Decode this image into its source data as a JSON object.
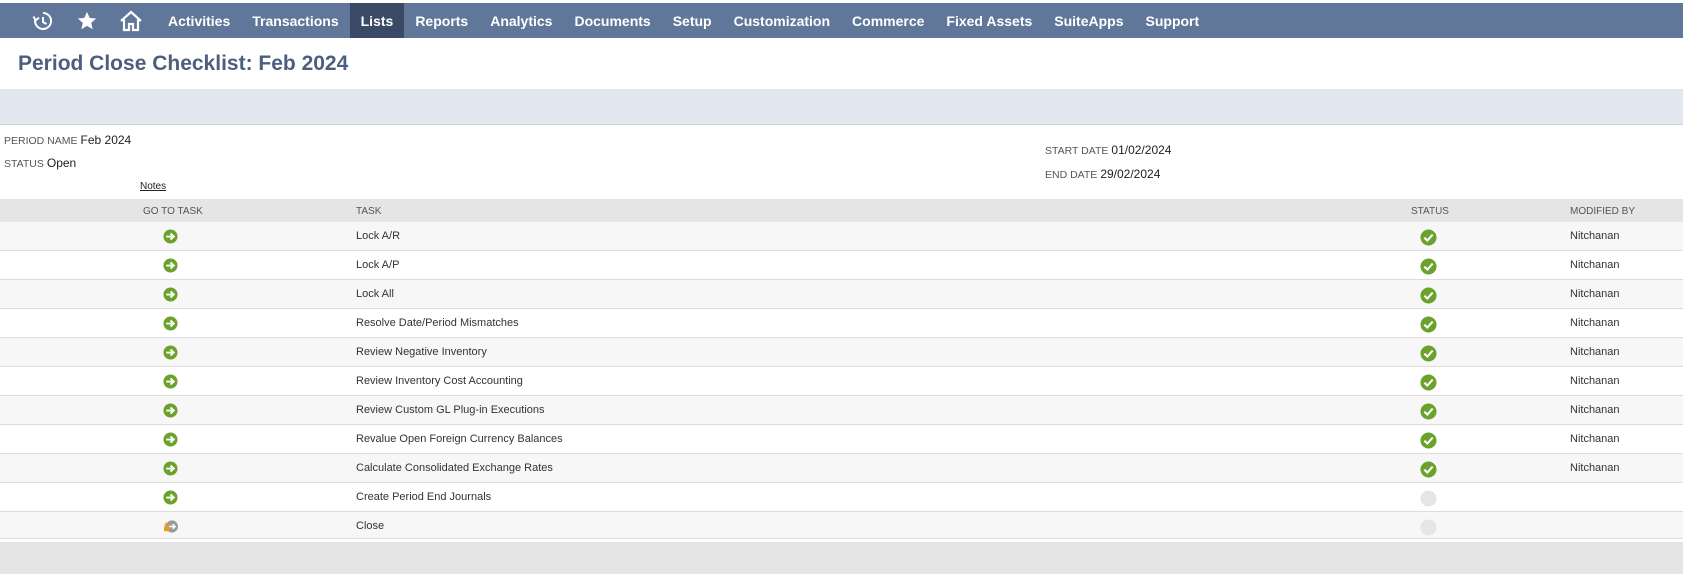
{
  "nav": {
    "icons": [
      "recent-records-icon",
      "star-icon",
      "home-icon"
    ],
    "items": [
      "Activities",
      "Transactions",
      "Lists",
      "Reports",
      "Analytics",
      "Documents",
      "Setup",
      "Customization",
      "Commerce",
      "Fixed Assets",
      "SuiteApps",
      "Support"
    ],
    "active": "Lists"
  },
  "page": {
    "title": "Period Close Checklist: Feb 2024"
  },
  "fields": {
    "period_name": {
      "label": "Period Name",
      "value": "Feb 2024"
    },
    "status": {
      "label": "Status",
      "value": "Open"
    },
    "notes": "Notes",
    "start_date": {
      "label": "Start Date",
      "value": "01/02/2024"
    },
    "end_date": {
      "label": "End Date",
      "value": "29/02/2024"
    }
  },
  "table": {
    "columns": [
      "Go To Task",
      "Task",
      "Status",
      "Modified By"
    ],
    "rows": [
      {
        "task": "Lock A/R",
        "status": "complete",
        "modified_by": "Nitchanan",
        "goto": "arrow"
      },
      {
        "task": "Lock A/P",
        "status": "complete",
        "modified_by": "Nitchanan",
        "goto": "arrow"
      },
      {
        "task": "Lock All",
        "status": "complete",
        "modified_by": "Nitchanan",
        "goto": "arrow"
      },
      {
        "task": "Resolve Date/Period Mismatches",
        "status": "complete",
        "modified_by": "Nitchanan",
        "goto": "arrow"
      },
      {
        "task": "Review Negative Inventory",
        "status": "complete",
        "modified_by": "Nitchanan",
        "goto": "arrow"
      },
      {
        "task": "Review Inventory Cost Accounting",
        "status": "complete",
        "modified_by": "Nitchanan",
        "goto": "arrow"
      },
      {
        "task": "Review Custom GL Plug-in Executions",
        "status": "complete",
        "modified_by": "Nitchanan",
        "goto": "arrow"
      },
      {
        "task": "Revalue Open Foreign Currency Balances",
        "status": "complete",
        "modified_by": "Nitchanan",
        "goto": "arrow"
      },
      {
        "task": "Calculate Consolidated Exchange Rates",
        "status": "complete",
        "modified_by": "Nitchanan",
        "goto": "arrow"
      },
      {
        "task": "Create Period End Journals",
        "status": "pending",
        "modified_by": "",
        "goto": "arrow"
      },
      {
        "task": "Close",
        "status": "pending",
        "modified_by": "",
        "goto": "locked"
      }
    ]
  },
  "colors": {
    "nav_bg": "#607799",
    "nav_active": "#3a4a66",
    "title": "#4d5f7f",
    "check_green": "#6aa22b",
    "pending_grey": "#e6e6e6"
  }
}
